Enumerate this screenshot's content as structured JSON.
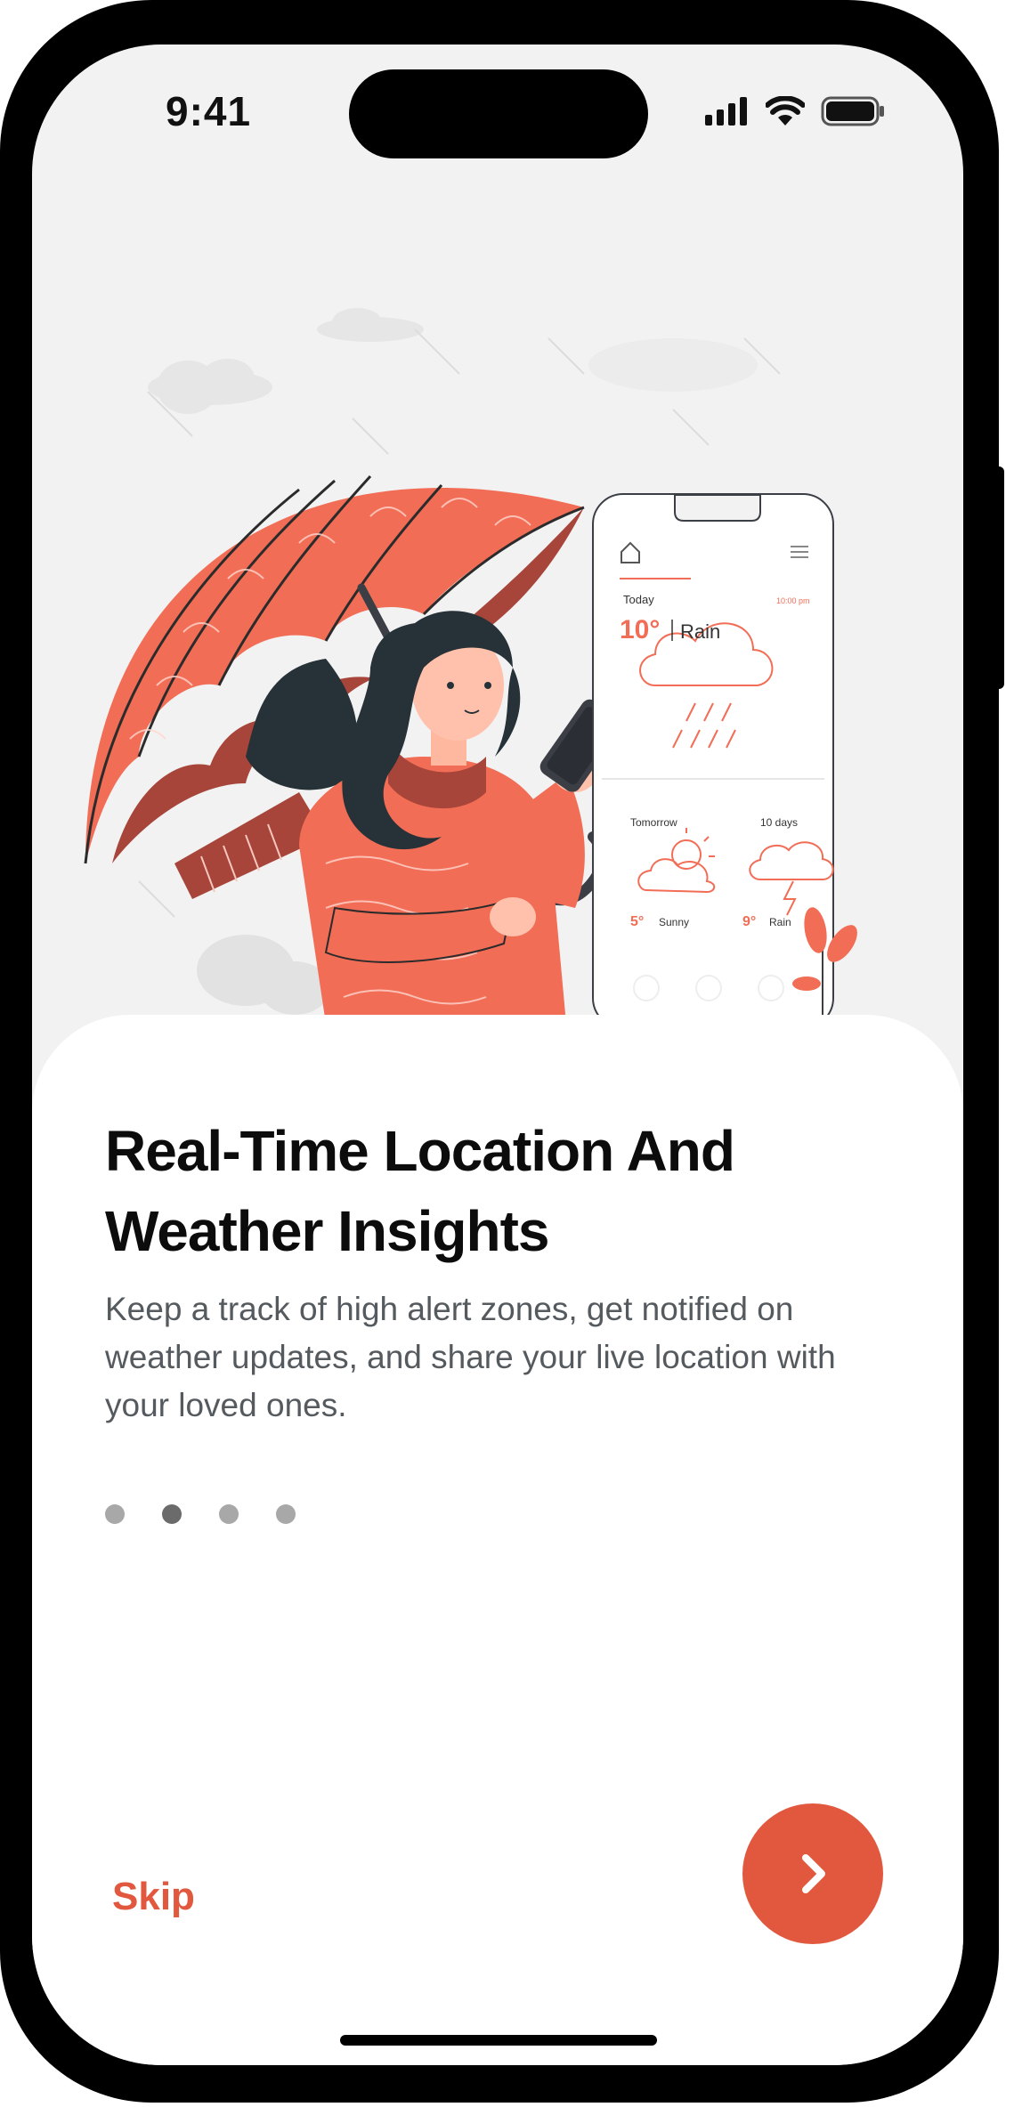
{
  "status_bar": {
    "time": "9:41",
    "signal_icon": "cellular-signal-icon",
    "wifi_icon": "wifi-icon",
    "battery_icon": "battery-icon"
  },
  "illustration": {
    "phone_screen": {
      "today_label": "Today",
      "time_label": "10:00 pm",
      "today_temp": "10°",
      "today_condition": "Rain",
      "tomorrow_label": "Tomorrow",
      "ten_days_label": "10 days",
      "tomorrow_temp": "5°",
      "tomorrow_condition": "Sunny",
      "ten_days_temp": "9°",
      "ten_days_condition": "Rain"
    }
  },
  "onboarding": {
    "title": "Real-Time Location And Weather Insights",
    "description": "Keep a track of high alert zones, get notified on weather updates, and share your live location with your loved ones.",
    "page_count": 4,
    "active_page": 2,
    "skip_label": "Skip",
    "next_icon": "chevron-right-icon"
  },
  "colors": {
    "accent": "#e1583f",
    "illustration_coral": "#f26d56",
    "illustration_dark_red": "#a8453a",
    "title": "#0c0c0c",
    "body_text": "#555a5f",
    "dot_inactive": "#a8a8a8",
    "dot_active": "#6b6b6b"
  }
}
